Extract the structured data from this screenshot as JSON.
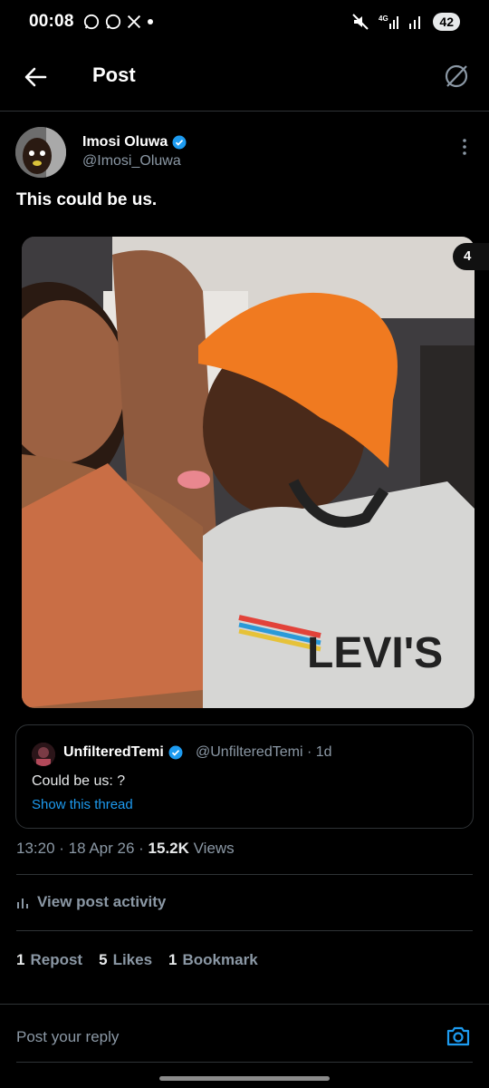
{
  "status": {
    "time": "00:08",
    "battery": "42"
  },
  "header": {
    "title": "Post"
  },
  "post": {
    "author_name": "Imosi Oluwa",
    "author_handle": "@Imosi_Oluwa",
    "text": "This could be us.",
    "media_count": "4",
    "media_shirt_text": "LEVI'S",
    "timestamp": "13:20 · 18 Apr 26 · ",
    "views_count": "15.2K",
    "views_label": " Views",
    "activity_label": "View post activity"
  },
  "quote": {
    "author_name": "UnfilteredTemi",
    "meta": "@UnfilteredTemi · 1d",
    "text": "Could be us: ?",
    "thread_link": "Show this thread"
  },
  "engagement": [
    {
      "count": "1",
      "label": "Repost"
    },
    {
      "count": "5",
      "label": "Likes"
    },
    {
      "count": "1",
      "label": "Bookmark"
    }
  ],
  "reply": {
    "placeholder": "Post your reply"
  },
  "colors": {
    "accent": "#1d9bf0",
    "background": "#000000",
    "muted": "#8b98a5",
    "divider": "#2f3336"
  }
}
